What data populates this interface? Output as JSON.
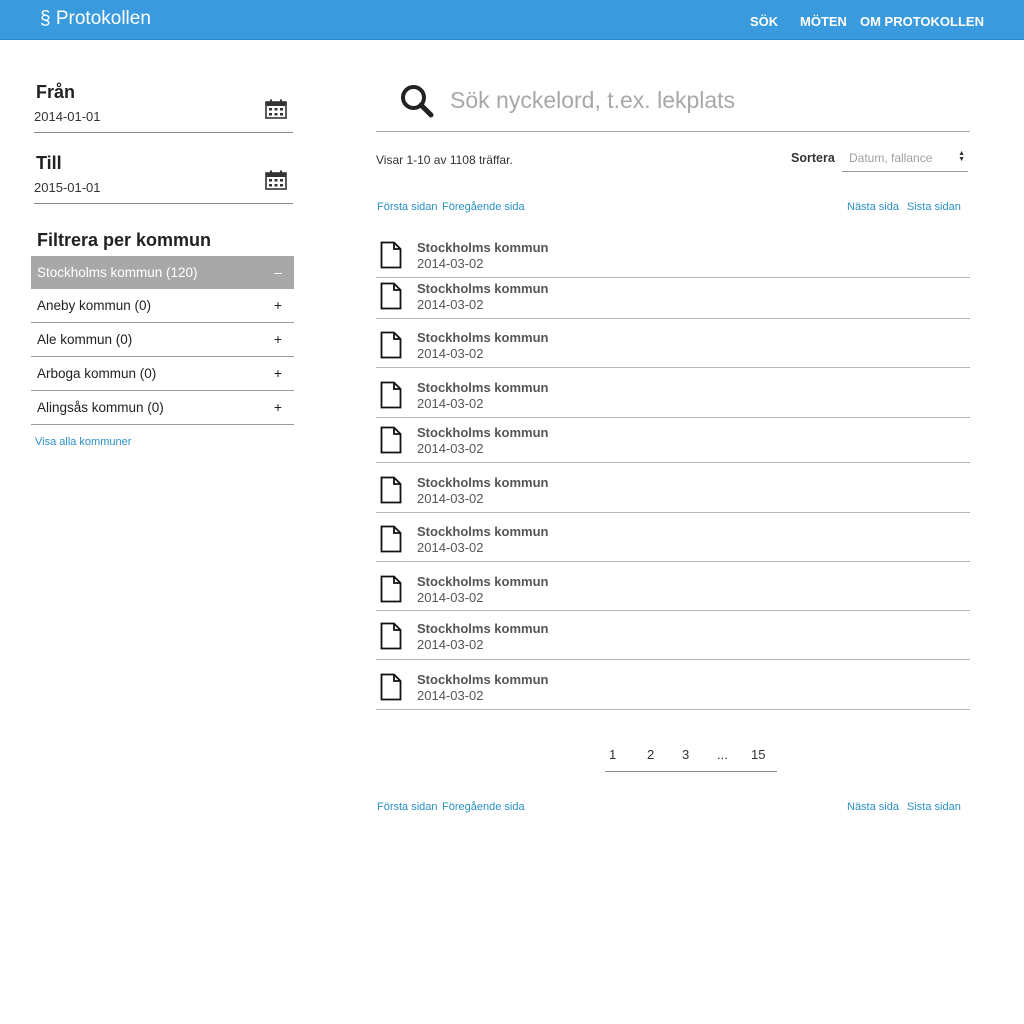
{
  "header": {
    "brand": "§ Protokollen",
    "nav": [
      "SÖK",
      "MÖTEN",
      "OM PROTOKOLLEN"
    ]
  },
  "sidebar": {
    "from_label": "Från",
    "from_value": "2014-01-01",
    "to_label": "Till",
    "to_value": "2015-01-01",
    "filter_heading": "Filtrera per kommun",
    "filters": [
      {
        "label": "Stockholms kommun (120)",
        "sign": "–"
      },
      {
        "label": "Aneby kommun (0)",
        "sign": "+"
      },
      {
        "label": "Ale kommun (0)",
        "sign": "+"
      },
      {
        "label": "Arboga kommun (0)",
        "sign": "+"
      },
      {
        "label": "Alingsås kommun (0)",
        "sign": "+"
      }
    ],
    "show_all": "Visa alla kommuner"
  },
  "search": {
    "placeholder": "Sök nyckelord, t.ex. lekplats"
  },
  "results_info": "Visar 1-10 av 1108 träffar.",
  "sort": {
    "label": "Sortera",
    "value": "Datum, fallance"
  },
  "paging_links": {
    "first": "Första sidan",
    "prev": "Föregående sida",
    "next": "Nästa sida",
    "last": "Sista sidan"
  },
  "results": [
    {
      "title": "Stockholms kommun",
      "date": "2014-03-02"
    },
    {
      "title": "Stockholms kommun",
      "date": "2014-03-02"
    },
    {
      "title": "Stockholms kommun",
      "date": "2014-03-02"
    },
    {
      "title": "Stockholms kommun",
      "date": "2014-03-02"
    },
    {
      "title": "Stockholms kommun",
      "date": "2014-03-02"
    },
    {
      "title": "Stockholms kommun",
      "date": "2014-03-02"
    },
    {
      "title": "Stockholms kommun",
      "date": "2014-03-02"
    },
    {
      "title": "Stockholms kommun",
      "date": "2014-03-02"
    },
    {
      "title": "Stockholms kommun",
      "date": "2014-03-02"
    },
    {
      "title": "Stockholms kommun",
      "date": "2014-03-02"
    }
  ],
  "pagination": [
    "1",
    "2",
    "3",
    "...",
    "15"
  ],
  "colors": {
    "header_bg": "#3a9ade",
    "link": "#2a8fc6",
    "active_filter_bg": "#a8a8a8"
  }
}
